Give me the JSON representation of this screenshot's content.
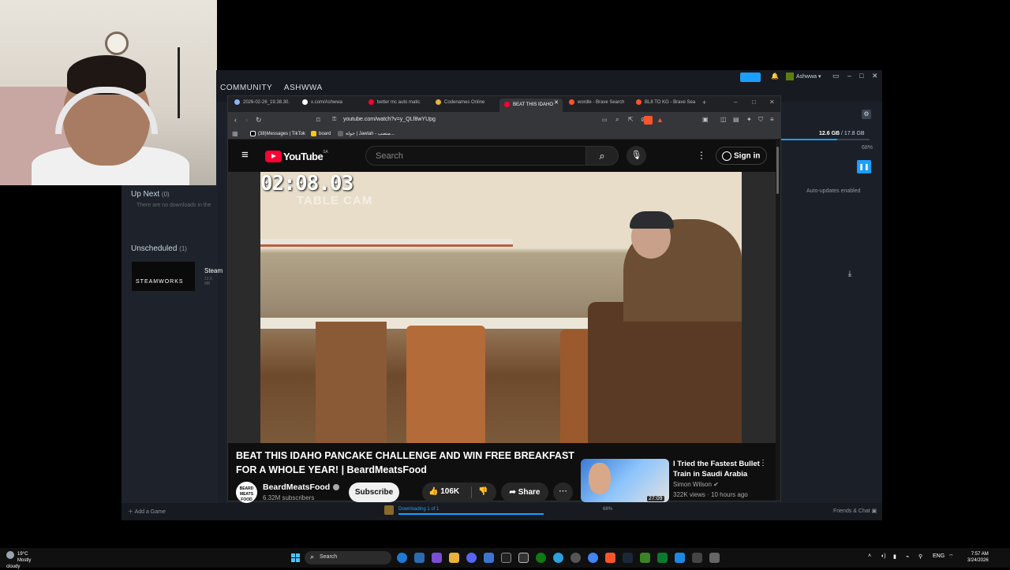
{
  "steam": {
    "nav": [
      "COMMUNITY",
      "ASHWWA"
    ],
    "user": "Ashwwa",
    "disk": "12.6 GB",
    "disk_total": "/ 17.8 GB",
    "percent": "68%",
    "auto_updates": "Auto-updates enabled",
    "up_next_label": "Up Next",
    "up_next_count": "(0)",
    "no_downloads": "There are no downloads in the",
    "unscheduled_label": "Unscheduled",
    "unscheduled_count": "(1)",
    "tile_text": "STEAMWORKS",
    "item_name": "Steam",
    "item_size": "12.6 MB",
    "add_game": "Add a Game",
    "download_status": "Downloading 1 of 1",
    "download_pct": "68%",
    "friends": "Friends & Chat"
  },
  "browser": {
    "tabs": [
      {
        "label": "2026-02-26_19.38.30.",
        "color": "#8ab4f8"
      },
      {
        "label": "x.com/Ashwwa",
        "color": "#ffffff"
      },
      {
        "label": "better mc auto matic",
        "color": "#ff0033"
      },
      {
        "label": "Codenames Online",
        "color": "#e8b339"
      },
      {
        "label": "BEAT THIS IDAHO",
        "color": "#ff0033"
      },
      {
        "label": "wordle - Brave Search",
        "color": "#fb542b"
      },
      {
        "label": "BL8 TO KG - Brave Sea",
        "color": "#fb542b"
      }
    ],
    "url": "youtube.com/watch?v=y_QLf8wYUpg",
    "bookmarks": [
      {
        "label": "(38)Messages | TikTok",
        "color": "#000000"
      },
      {
        "label": "board",
        "color": "#f5c518"
      },
      {
        "label": "جولة | Jawlah - منصب...",
        "color": "#666666"
      }
    ]
  },
  "youtube": {
    "logo_text": "YouTube",
    "region": "SA",
    "search_placeholder": "Search",
    "sign_in": "Sign in",
    "timer_overlay": "02:08.03",
    "cam_label": "TABLE CAM",
    "video_title": "BEAT THIS IDAHO PANCAKE CHALLENGE AND WIN FREE BREAKFAST FOR A WHOLE YEAR! | BeardMeatsFood",
    "channel_name": "BeardMeatsFood",
    "channel_avatar_text": "BEARD MEATS FOOD",
    "subscribers": "6.32M subscribers",
    "subscribe": "Subscribe",
    "likes": "106K",
    "share": "Share",
    "rec_title": "I Tried the Fastest Bullet Train in Saudi Arabia",
    "rec_channel": "Simon Wilson",
    "rec_meta": "322K views · 10 hours ago",
    "rec_duration": "27:09"
  },
  "taskbar": {
    "temp": "19°C",
    "weather": "Mostly cloudy",
    "search": "Search",
    "lang": "ENG",
    "time": "7:57 AM",
    "date": "3/24/2026",
    "icons": [
      "edge",
      "mail",
      "files",
      "store",
      "explorer",
      "notes",
      "terminal",
      "xbox",
      "telegram",
      "steam"
    ]
  }
}
